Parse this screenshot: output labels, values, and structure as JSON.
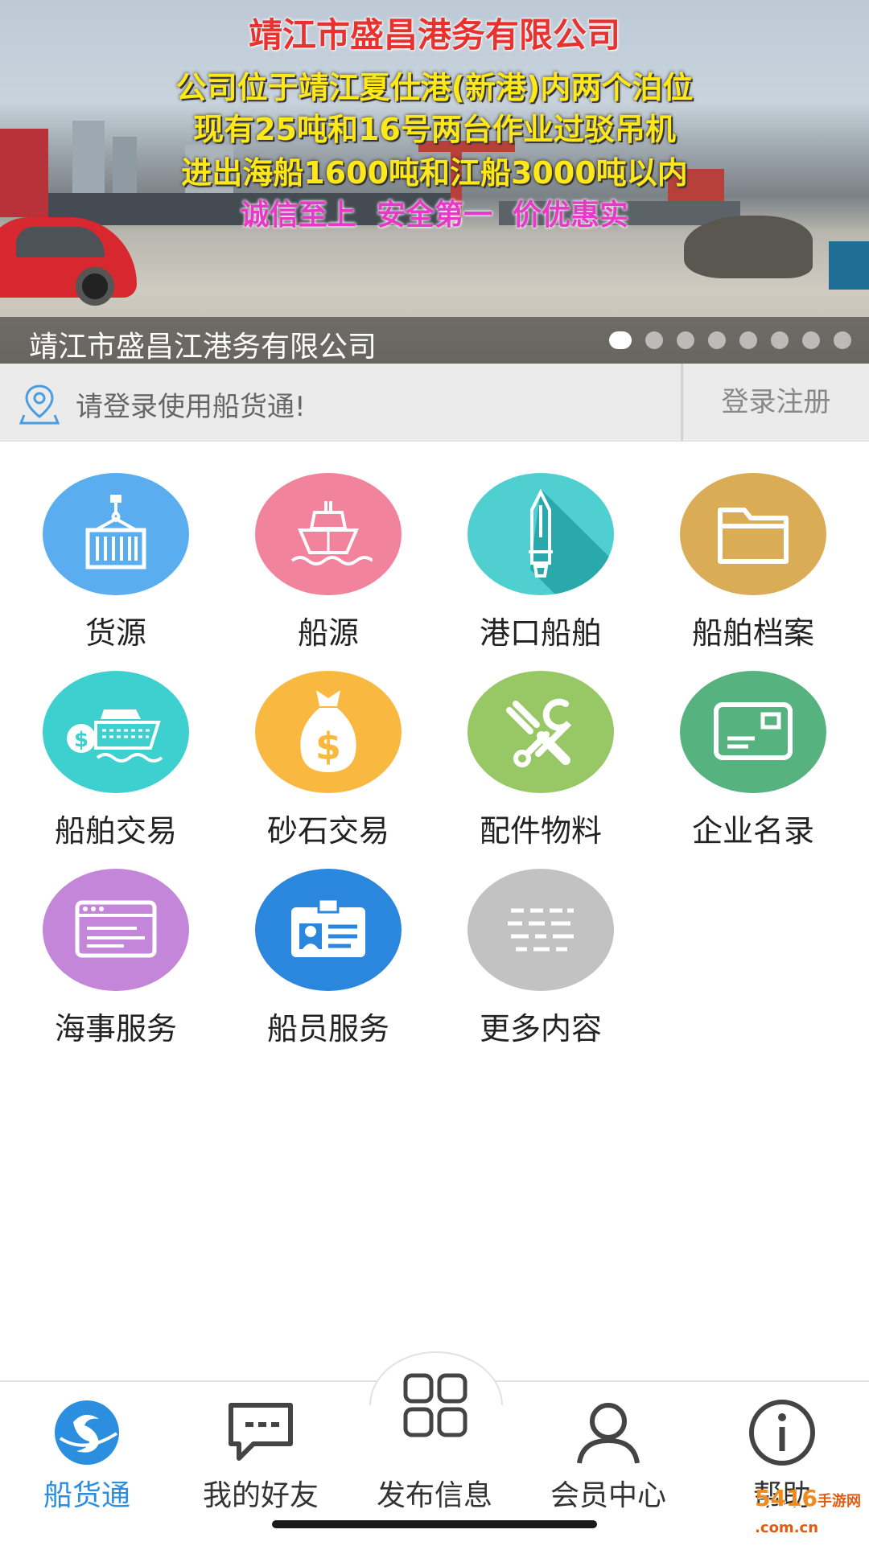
{
  "banner": {
    "title": "靖江市盛昌港务有限公司",
    "lines": [
      "公司位于靖江夏仕港(新港)内两个泊位",
      "现有25吨和16号两台作业过驳吊机",
      "进出海船1600吨和江船3000吨以内"
    ],
    "slogan": "诚信至上  安全第一  价优惠实",
    "caption": "靖江市盛昌江港务有限公司",
    "slide_count": 8,
    "active_slide": 1
  },
  "login": {
    "prompt": "请登录使用船货通!",
    "button": "登录注册",
    "icon": "location-pin-icon"
  },
  "grid": [
    {
      "label": "货源",
      "icon": "container-crane-icon",
      "color": "#5aaef0"
    },
    {
      "label": "船源",
      "icon": "ship-icon",
      "color": "#f2839c"
    },
    {
      "label": "港口船舶",
      "icon": "anchored-ship-icon",
      "color": "#4fcfcf"
    },
    {
      "label": "船舶档案",
      "icon": "folder-icon",
      "color": "#d9ac55"
    },
    {
      "label": "船舶交易",
      "icon": "ship-trade-icon",
      "color": "#3dd0cf"
    },
    {
      "label": "砂石交易",
      "icon": "money-bag-icon",
      "color": "#f9b83f"
    },
    {
      "label": "配件物料",
      "icon": "tools-icon",
      "color": "#98c765"
    },
    {
      "label": "企业名录",
      "icon": "business-card-icon",
      "color": "#56b27f"
    },
    {
      "label": "海事服务",
      "icon": "browser-window-icon",
      "color": "#c486d9"
    },
    {
      "label": "船员服务",
      "icon": "id-badge-icon",
      "color": "#2b87dd"
    },
    {
      "label": "更多内容",
      "icon": "more-list-icon",
      "color": "#c2c2c2"
    }
  ],
  "nav": [
    {
      "label": "船货通",
      "icon": "logo-icon",
      "active": true
    },
    {
      "label": "我的好友",
      "icon": "chat-bubble-icon",
      "active": false
    },
    {
      "label": "发布信息",
      "icon": "grid-icon",
      "active": false
    },
    {
      "label": "会员中心",
      "icon": "user-icon",
      "active": false
    },
    {
      "label": "帮助",
      "icon": "info-icon",
      "active": false
    }
  ],
  "colors": {
    "accent": "#2b8ede",
    "login_bg": "#ebebeb"
  },
  "watermark": {
    "main": "5416",
    "sub": "手游网",
    "domain": ".com.cn"
  }
}
